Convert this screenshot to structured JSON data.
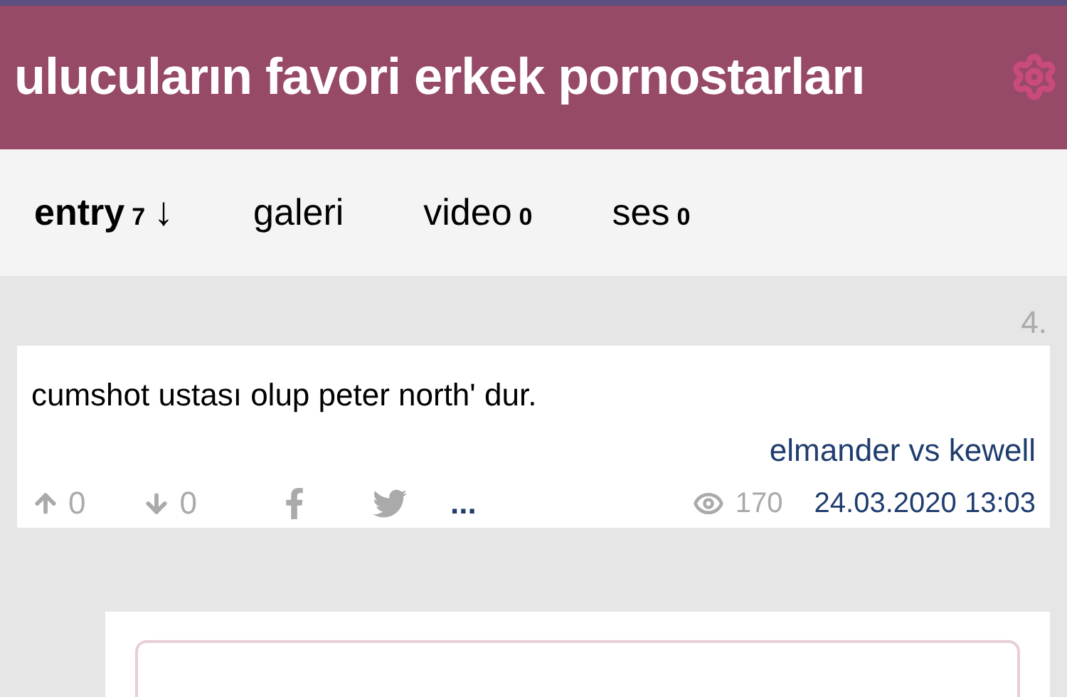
{
  "header": {
    "title": "ulucuların favori erkek pornostarları"
  },
  "tabs": [
    {
      "label": "entry",
      "count": "7",
      "sort": "↓",
      "selected": true
    },
    {
      "label": "galeri",
      "selected": false
    },
    {
      "label": "video",
      "count": "0",
      "selected": false
    },
    {
      "label": "ses",
      "count": "0",
      "selected": false
    }
  ],
  "entry": {
    "number": "4.",
    "text": "cumshot ustası olup peter north' dur.",
    "author": "elmander vs kewell",
    "upvotes": "0",
    "downvotes": "0",
    "more": "...",
    "views": "170",
    "date": "24.03.2020 13:03"
  }
}
